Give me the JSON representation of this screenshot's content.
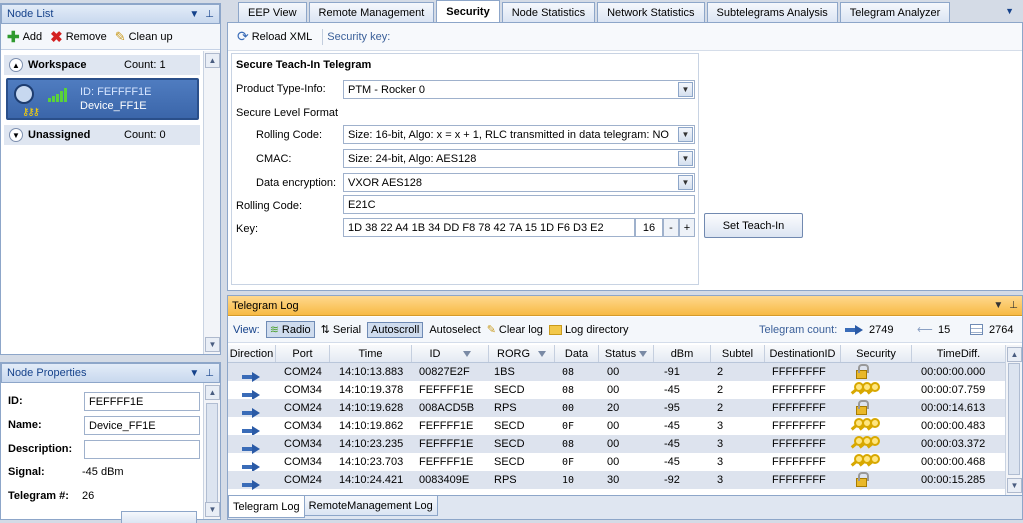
{
  "node_list": {
    "title": "Node List",
    "toolbar": {
      "add": "Add",
      "remove": "Remove",
      "clean_up": "Clean up"
    },
    "groups": [
      {
        "name": "Workspace",
        "count_label": "Count: 1"
      },
      {
        "name": "Unassigned",
        "count_label": "Count: 0"
      }
    ],
    "device": {
      "id_label": "ID: FEFFFF1E",
      "name": "Device_FF1E"
    }
  },
  "node_properties": {
    "title": "Node Properties",
    "id_label": "ID:",
    "id_value": "FEFFFF1E",
    "name_label": "Name:",
    "name_value": "Device_FF1E",
    "description_label": "Description:",
    "description_value": "",
    "signal_label": "Signal:",
    "signal_value": "-45 dBm",
    "telegram_label": "Telegram #:",
    "telegram_value": "26"
  },
  "tabs": [
    "EEP View",
    "Remote Management",
    "Security",
    "Node Statistics",
    "Network Statistics",
    "Subtelegrams Analysis",
    "Telegram Analyzer"
  ],
  "active_tab": "Security",
  "security": {
    "toolbar": {
      "reload": "Reload XML",
      "security_key": "Security key:"
    },
    "section_title": "Secure Teach-In Telegram",
    "product_type_label": "Product Type-Info:",
    "product_type_value": "PTM - Rocker 0",
    "secure_level_label": "Secure Level Format",
    "rolling_code_label": "Rolling Code:",
    "rolling_code_value": "Size: 16-bit, Algo: x = x + 1, RLC transmitted in data telegram: NO",
    "cmac_label": "CMAC:",
    "cmac_value": "Size: 24-bit, Algo: AES128",
    "data_enc_label": "Data encryption:",
    "data_enc_value": "VXOR AES128",
    "rolling_code2_label": "Rolling Code:",
    "rolling_code2_value": "E21C",
    "key_label": "Key:",
    "key_value": "1D 38 22 A4 1B 34 DD F8 78 42 7A 15 1D F6 D3 E2",
    "key_len": "16",
    "minus": "-",
    "plus": "+",
    "set_teach_in": "Set Teach-In"
  },
  "telegram_log": {
    "title": "Telegram Log",
    "view_label": "View:",
    "radio": "Radio",
    "serial": "Serial",
    "autoscroll": "Autoscroll",
    "autoselect": "Autoselect",
    "clear_log": "Clear log",
    "log_directory": "Log directory",
    "count_label": "Telegram count:",
    "count_in": "2749",
    "count_out": "15",
    "count_total": "2764",
    "columns": [
      "Direction",
      "Port",
      "Time",
      "ID",
      "RORG",
      "Data",
      "Status",
      "dBm",
      "Subtel",
      "DestinationID",
      "Security",
      "TimeDiff."
    ],
    "rows": [
      {
        "port": "COM24",
        "time": "14:10:13.883",
        "id": "00827E2F",
        "rorg": "1BS",
        "data": "08",
        "status": "00",
        "dbm": "-91",
        "subtel": "2",
        "dest": "FFFFFFFF",
        "security": "lock",
        "timediff": "00:00:00.000"
      },
      {
        "port": "COM34",
        "time": "14:10:19.378",
        "id": "FEFFFF1E",
        "rorg": "SECD",
        "data": "08",
        "status": "00",
        "dbm": "-45",
        "subtel": "2",
        "dest": "FFFFFFFF",
        "security": "keys",
        "timediff": "00:00:07.759"
      },
      {
        "port": "COM24",
        "time": "14:10:19.628",
        "id": "008ACD5B",
        "rorg": "RPS",
        "data": "00",
        "status": "20",
        "dbm": "-95",
        "subtel": "2",
        "dest": "FFFFFFFF",
        "security": "lock",
        "timediff": "00:00:14.613"
      },
      {
        "port": "COM34",
        "time": "14:10:19.862",
        "id": "FEFFFF1E",
        "rorg": "SECD",
        "data": "0F",
        "status": "00",
        "dbm": "-45",
        "subtel": "3",
        "dest": "FFFFFFFF",
        "security": "keys",
        "timediff": "00:00:00.483"
      },
      {
        "port": "COM34",
        "time": "14:10:23.235",
        "id": "FEFFFF1E",
        "rorg": "SECD",
        "data": "08",
        "status": "00",
        "dbm": "-45",
        "subtel": "3",
        "dest": "FFFFFFFF",
        "security": "keys",
        "timediff": "00:00:03.372"
      },
      {
        "port": "COM34",
        "time": "14:10:23.703",
        "id": "FEFFFF1E",
        "rorg": "SECD",
        "data": "0F",
        "status": "00",
        "dbm": "-45",
        "subtel": "3",
        "dest": "FFFFFFFF",
        "security": "keys",
        "timediff": "00:00:00.468"
      },
      {
        "port": "COM24",
        "time": "14:10:24.421",
        "id": "0083409E",
        "rorg": "RPS",
        "data": "10",
        "status": "30",
        "dbm": "-92",
        "subtel": "3",
        "dest": "FFFFFFFF",
        "security": "lock",
        "timediff": "00:00:15.285"
      }
    ],
    "bottom_tabs": [
      "Telegram Log",
      "RemoteManagement Log"
    ]
  }
}
